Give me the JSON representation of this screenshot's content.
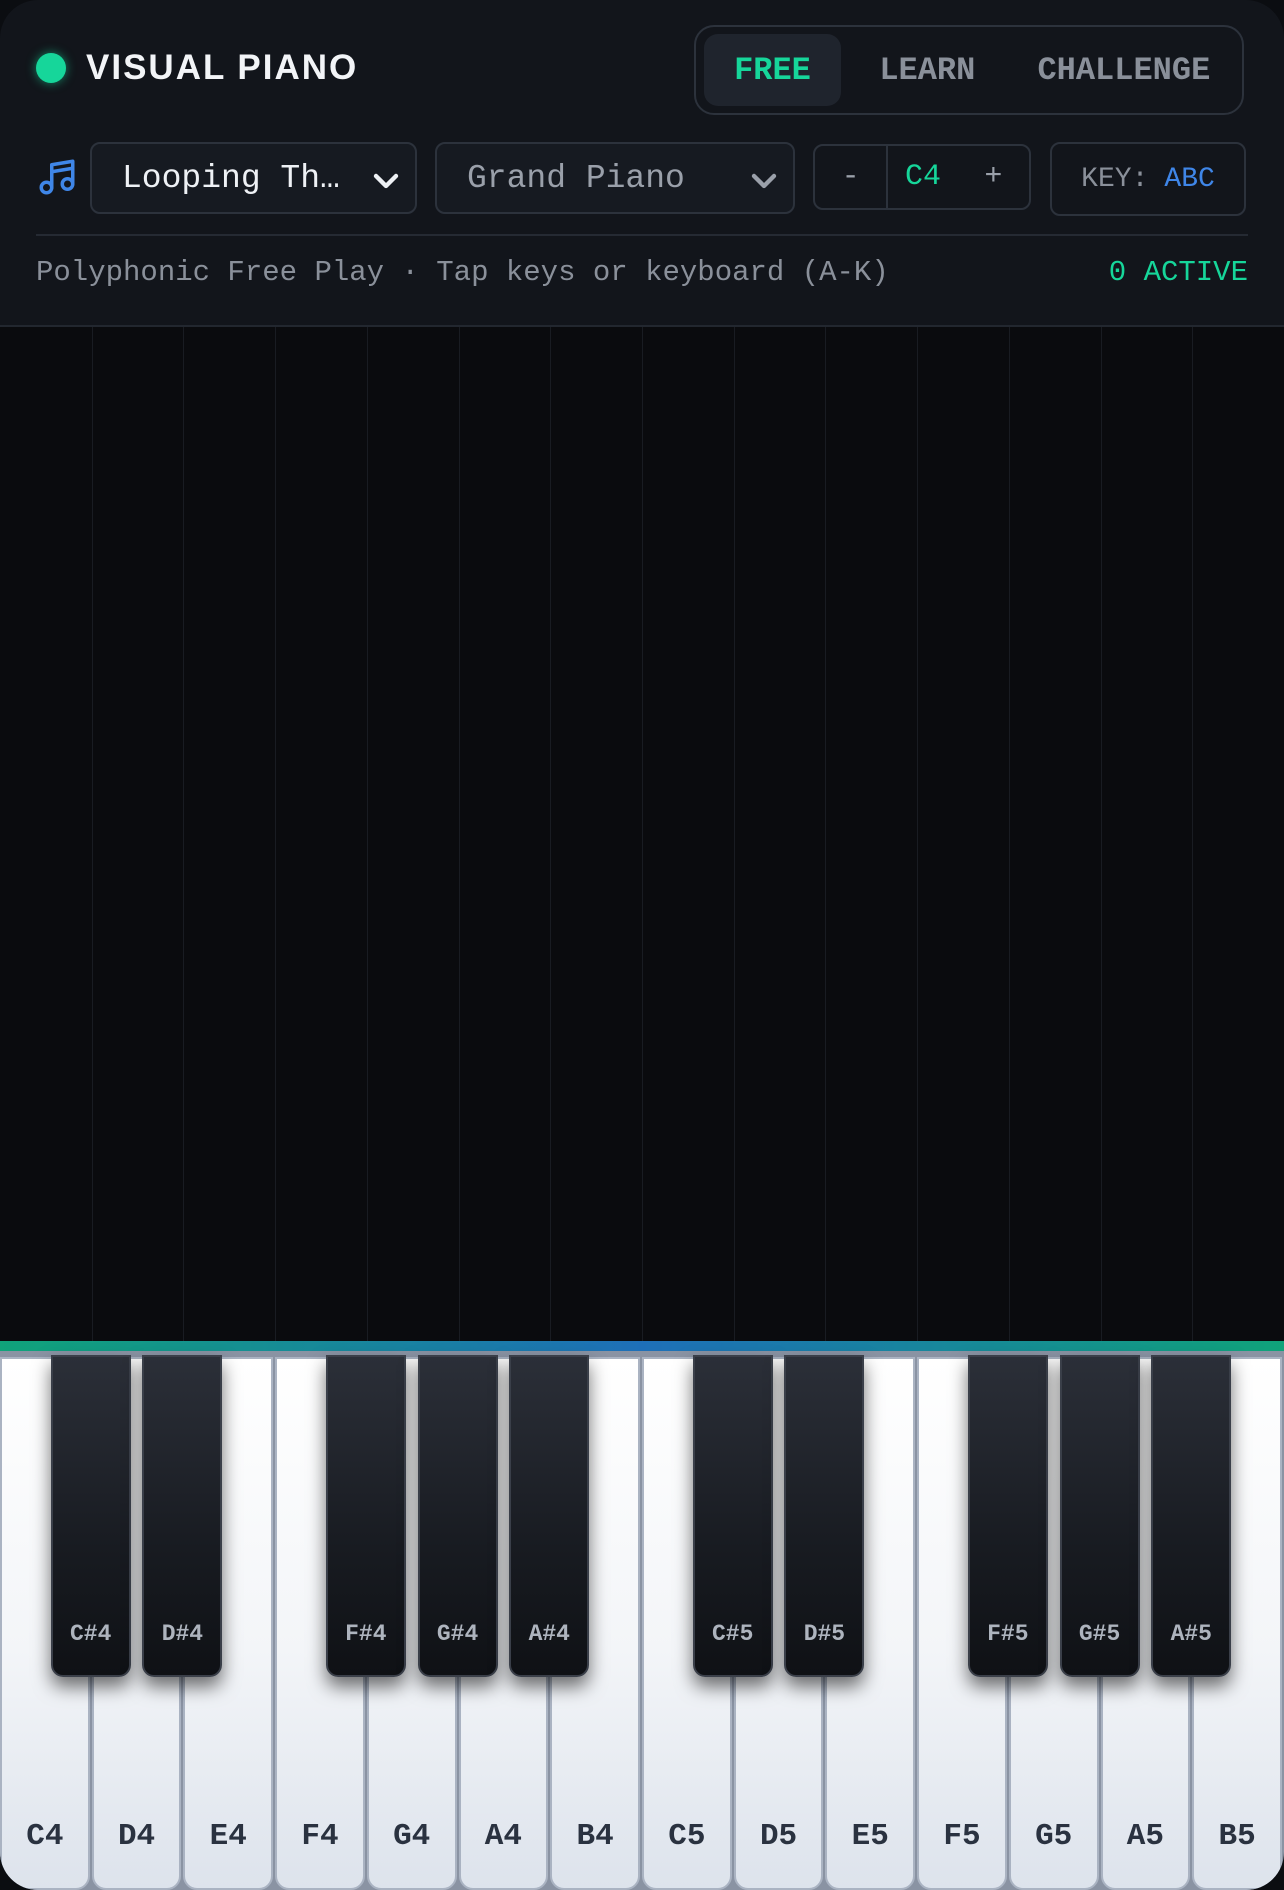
{
  "app": {
    "title": "VISUAL PIANO"
  },
  "colors": {
    "accent": "#16d69a",
    "blue": "#3f86e8",
    "background": "#0a0b0e",
    "panel": "#12151b"
  },
  "modes": [
    {
      "label": "FREE",
      "active": true
    },
    {
      "label": "LEARN",
      "active": false
    },
    {
      "label": "CHALLENGE",
      "active": false
    }
  ],
  "controls": {
    "icon": "music-note-icon",
    "song": "Looping Th…",
    "instrument": "Grand Piano",
    "octave_minus": "-",
    "octave": "C4",
    "octave_plus": "+",
    "key_label_prefix": "KEY:",
    "key_label_value": "ABC"
  },
  "status": {
    "text": "Polyphonic Free Play · Tap keys or keyboard (A-K)",
    "active": "0 ACTIVE"
  },
  "keyboard": {
    "white_keys": [
      "C4",
      "D4",
      "E4",
      "F4",
      "G4",
      "A4",
      "B4",
      "C5",
      "D5",
      "E5",
      "F5",
      "G5",
      "A5",
      "B5"
    ],
    "black_keys": [
      "C#4",
      "D#4",
      "F#4",
      "G#4",
      "A#4",
      "C#5",
      "D#5",
      "F#5",
      "G#5",
      "A#5"
    ]
  }
}
